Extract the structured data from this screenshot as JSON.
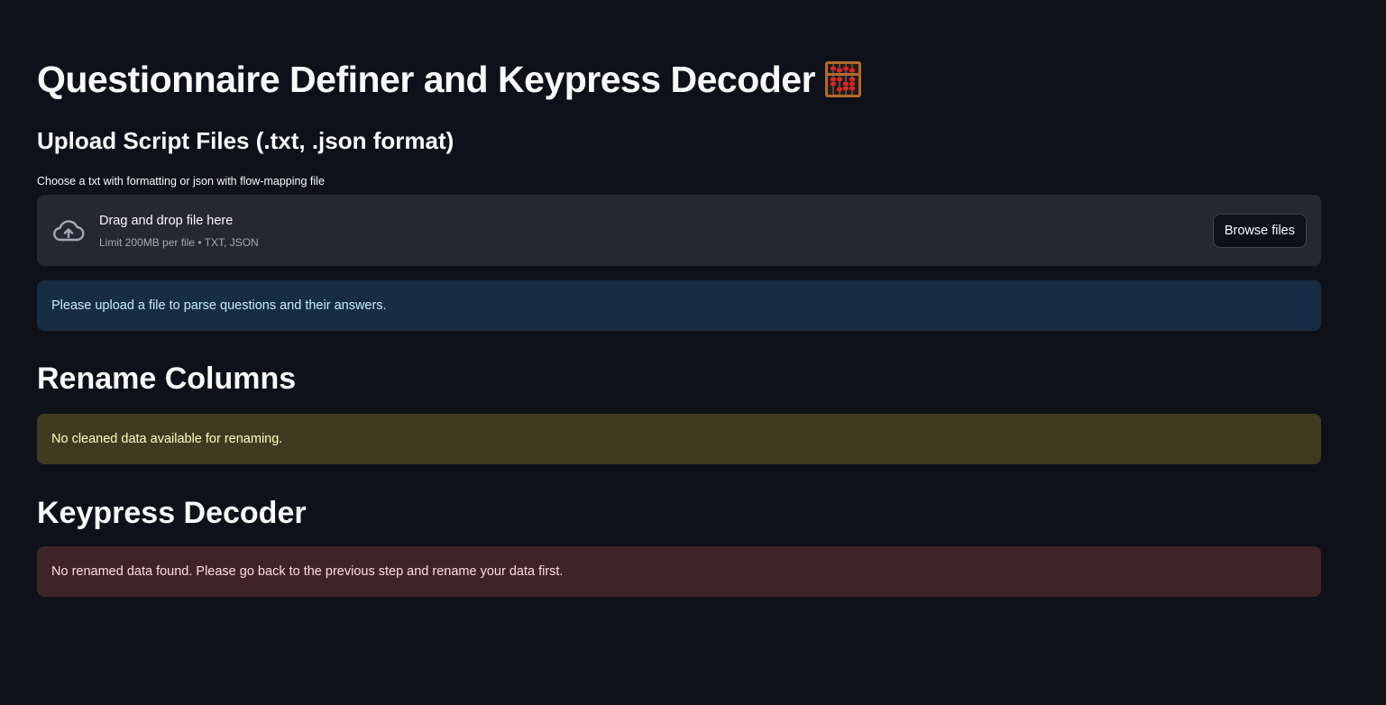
{
  "header": {
    "title": "Questionnaire Definer and Keypress Decoder",
    "title_icon": "abacus-emoji-icon"
  },
  "upload": {
    "heading": "Upload Script Files (.txt, .json format)",
    "label": "Choose a txt with formatting or json with flow-mapping file",
    "drop_title": "Drag and drop file here",
    "drop_limit": "Limit 200MB per file • TXT, JSON",
    "browse_label": "Browse files",
    "icon": "cloud-upload-icon",
    "info_message": "Please upload a file to parse questions and their answers."
  },
  "rename": {
    "heading": "Rename Columns",
    "warning_message": "No cleaned data available for renaming."
  },
  "keypress": {
    "heading": "Keypress Decoder",
    "error_message": "No renamed data found. Please go back to the previous step and rename your data first."
  },
  "colors": {
    "background": "#0e1117",
    "text": "#fafafa",
    "dropzone": "#262730",
    "info_bg": "#172d43",
    "info_text": "#c7ebff",
    "warning_bg": "#3e3b20",
    "warning_text": "#ffffc2",
    "error_bg": "#3e2428",
    "error_text": "#ffdede"
  }
}
